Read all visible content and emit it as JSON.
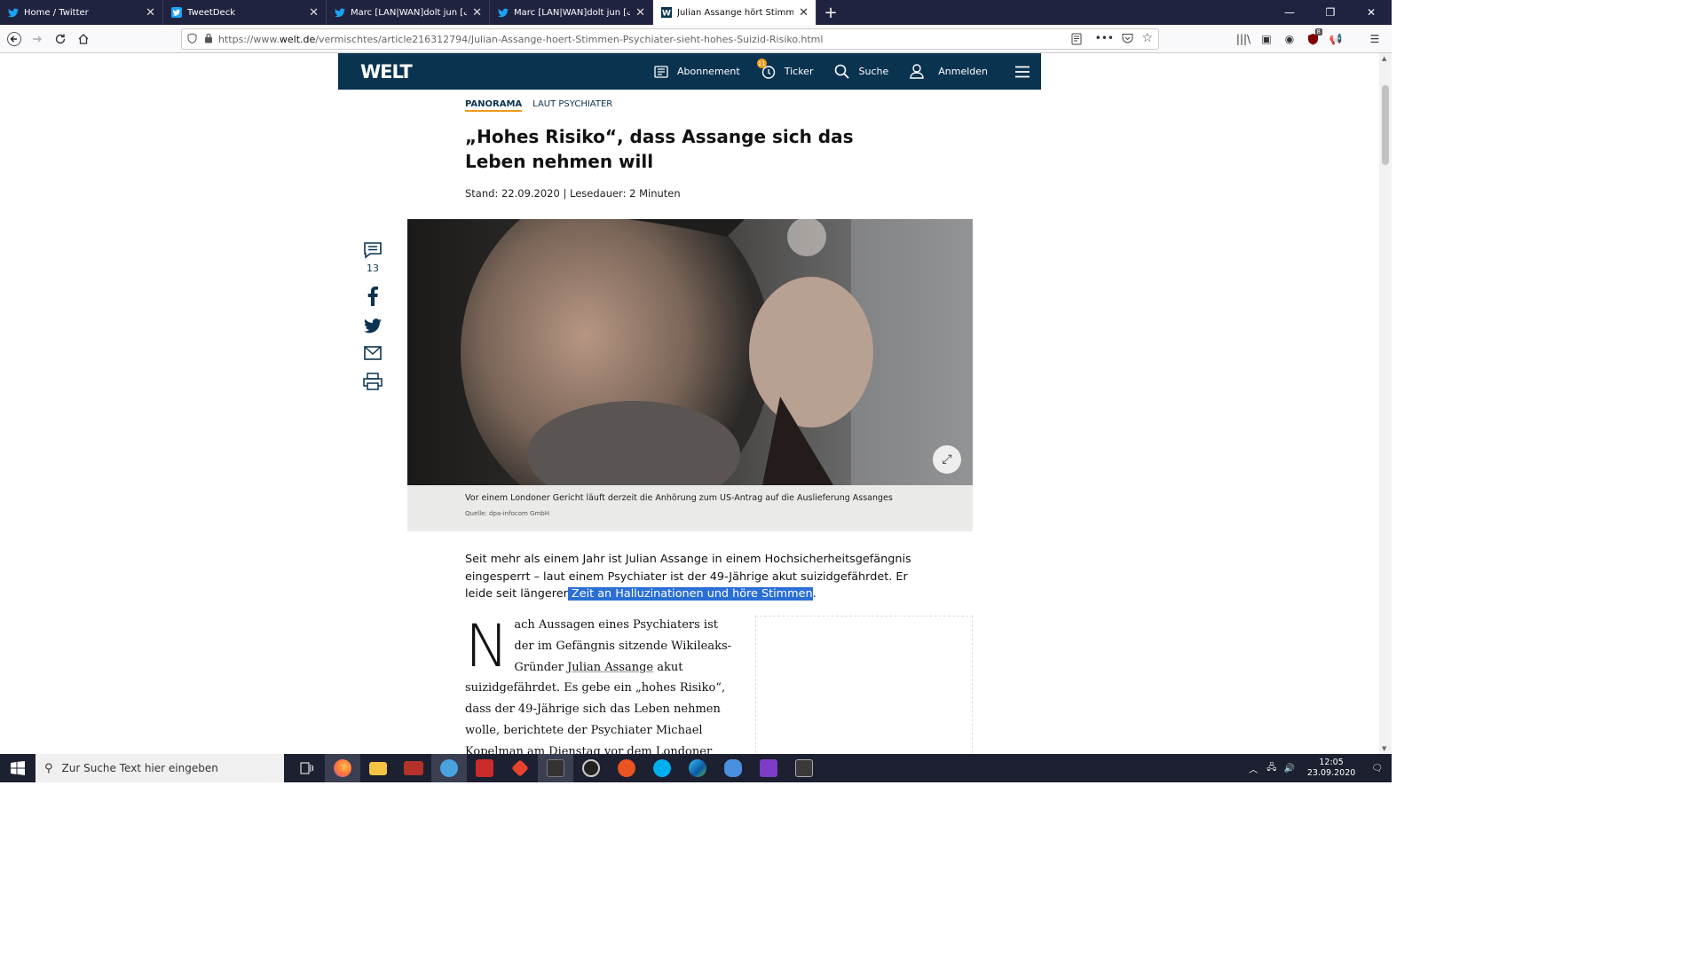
{
  "browser": {
    "tabs": [
      {
        "label": "Home / Twitter",
        "icon": "twitter-icon",
        "active": false
      },
      {
        "label": "TweetDeck",
        "icon": "tweetdeck-icon",
        "active": false
      },
      {
        "label": "Marc [LAN|WAN]dolt jun [ولت...",
        "icon": "twitter-icon",
        "active": false
      },
      {
        "label": "Marc [LAN|WAN]dolt jun [ولت...",
        "icon": "twitter-icon",
        "active": false
      },
      {
        "label": "Julian Assange hört Stimmen: P",
        "icon": "welt-icon",
        "active": true
      }
    ],
    "url_prefix": "https://www.",
    "url_domain": "welt.de",
    "url_path": "/vermischtes/article216312794/Julian-Assange-hoert-Stimmen-Psychiater-sieht-hohes-Suizid-Risiko.html",
    "extension_badge": "8"
  },
  "site": {
    "logo": "WELT",
    "nav": {
      "abo": "Abonnement",
      "ticker": "Ticker",
      "ticker_badge": "11",
      "search": "Suche",
      "login": "Anmelden"
    },
    "accent": "#f19a1a",
    "brand": "#0a3350"
  },
  "article": {
    "kicker_section": "PANORAMA",
    "kicker_topic": "LAUT PSYCHIATER",
    "headline": "„Hohes Risiko“, dass Assange sich das Leben nehmen will",
    "meta": "Stand: 22.09.2020 | Lesedauer: 2 Minuten",
    "comments_count": "13",
    "caption": "Vor einem Londoner Gericht läuft derzeit die Anhörung zum US-Antrag auf die Auslieferung Assanges",
    "source": "Quelle: dpa-infocom GmbH",
    "intro_plain": "Seit mehr als einem Jahr ist Julian Assange in einem Hochsicherheitsgefängnis eingesperrt – laut einem Psychiater ist der 49-Jährige akut suizidgefährdet. Er leide seit längerer",
    "intro_highlight": " Zeit an Halluzinationen und höre Stimmen",
    "intro_end": ".",
    "dropcap": "N",
    "body_a": "ach Aussagen eines Psychiaters ist der im Gefängnis sitzende Wikileaks-Gründer ",
    "body_link": "Julian Assange",
    "body_b": " akut suizidgefährdet. Es gebe ein „hohes Risiko“, dass der 49-Jährige sich das Leben nehmen wolle, berichtete der Psychiater Michael Kopelman am Dienstag vor dem Londoner Old-Bailey-Gericht."
  },
  "taskbar": {
    "search_placeholder": "Zur Suche Text hier eingeben",
    "time": "12:05",
    "date": "23.09.2020"
  }
}
